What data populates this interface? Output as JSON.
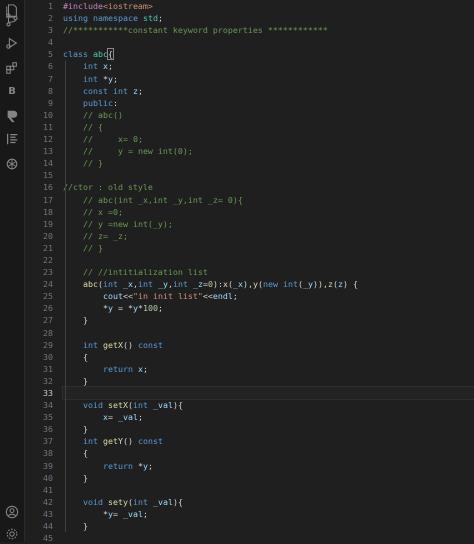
{
  "activity_bar": {
    "icons": [
      "files-icon",
      "source-control-icon",
      "run-debug-icon",
      "extensions-icon",
      "b-extension-icon",
      "remote-explorer-icon",
      "testing-icon",
      "openai-icon",
      "account-icon",
      "settings-gear-icon"
    ],
    "b_label": "B"
  },
  "editor": {
    "active_line": 33,
    "lines": [
      {
        "n": "1",
        "t": "#include<iostream>"
      },
      {
        "n": "2",
        "t": "using namespace std;"
      },
      {
        "n": "3",
        "t": "//***********constant keyword properties ************"
      },
      {
        "n": "4",
        "t": ""
      },
      {
        "n": "5",
        "t": "class abc{"
      },
      {
        "n": "6",
        "t": "    int x;"
      },
      {
        "n": "7",
        "t": "    int *y;"
      },
      {
        "n": "8",
        "t": "    const int z;"
      },
      {
        "n": "9",
        "t": "    public:"
      },
      {
        "n": "10",
        "t": "    // abc()"
      },
      {
        "n": "11",
        "t": "    // {"
      },
      {
        "n": "12",
        "t": "    //     x= 0;"
      },
      {
        "n": "13",
        "t": "    //     y = new int(0);"
      },
      {
        "n": "14",
        "t": "    // }"
      },
      {
        "n": "15",
        "t": ""
      },
      {
        "n": "16",
        "t": "//ctor : old style"
      },
      {
        "n": "17",
        "t": "    // abc(int _x,int _y,int _z= 0){"
      },
      {
        "n": "18",
        "t": "    // x =0;"
      },
      {
        "n": "19",
        "t": "    // y =new int(_y);"
      },
      {
        "n": "20",
        "t": "    // z= _z;"
      },
      {
        "n": "21",
        "t": "    // }"
      },
      {
        "n": "22",
        "t": ""
      },
      {
        "n": "23",
        "t": "    // //intitialization list"
      },
      {
        "n": "24",
        "t": "    abc(int _x,int _y,int _z=0):x(_x),y(new int(_y)),z(z) {"
      },
      {
        "n": "25",
        "t": "        cout<<\"in init list\"<<endl;"
      },
      {
        "n": "26",
        "t": "        *y = *y*100;"
      },
      {
        "n": "27",
        "t": "    }"
      },
      {
        "n": "28",
        "t": ""
      },
      {
        "n": "29",
        "t": "    int getX() const"
      },
      {
        "n": "30",
        "t": "    {"
      },
      {
        "n": "31",
        "t": "        return x;"
      },
      {
        "n": "32",
        "t": "    }"
      },
      {
        "n": "33",
        "t": ""
      },
      {
        "n": "34",
        "t": "    void setX(int _val){"
      },
      {
        "n": "35",
        "t": "        x= _val;"
      },
      {
        "n": "36",
        "t": "    }"
      },
      {
        "n": "37",
        "t": "    int getY() const"
      },
      {
        "n": "38",
        "t": "    {"
      },
      {
        "n": "39",
        "t": "        return *y;"
      },
      {
        "n": "40",
        "t": "    }"
      },
      {
        "n": "41",
        "t": ""
      },
      {
        "n": "42",
        "t": "    void sety(int _val){"
      },
      {
        "n": "43",
        "t": "        *y= _val;"
      },
      {
        "n": "44",
        "t": "    }"
      },
      {
        "n": "45",
        "t": ""
      }
    ]
  }
}
